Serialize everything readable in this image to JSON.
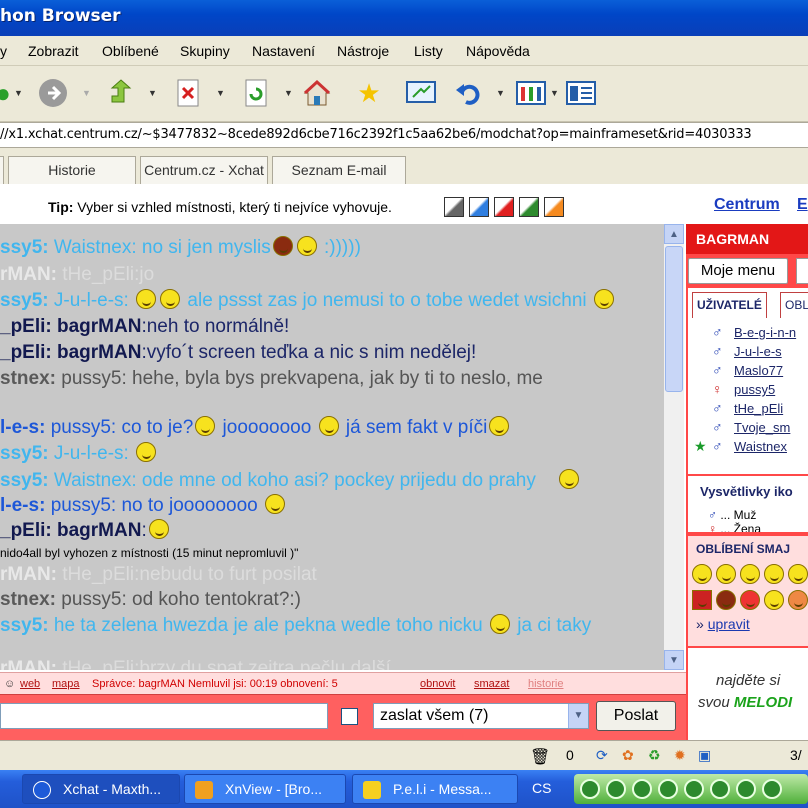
{
  "window": {
    "title": "hon Browser"
  },
  "menu": [
    "y",
    "Zobrazit",
    "Oblíbené",
    "Skupiny",
    "Nastavení",
    "Nástroje",
    "Listy",
    "Nápověda"
  ],
  "address": "//x1.xchat.centrum.cz/~$3477832~8cede892d6cbe716c2392f1c5aa62be6/modchat?op=mainframeset&rid=4030333",
  "tabs": [
    "Historie",
    "Centrum.cz - Xchat",
    "Seznam E-mail"
  ],
  "tip": {
    "label": "Tip:",
    "text": "Vyber si vzhled místnosti, který ti nejvíce vyhovuje."
  },
  "top_links": [
    "Centrum",
    "E"
  ],
  "chat": [
    {
      "speaker": "ssy5:",
      "text": "Waistnex: no si jen myslis",
      "tail": " :)))))",
      "style": "light"
    },
    {
      "speaker": "rMAN:",
      "text": "tHe_pEli:jo",
      "style": "grey"
    },
    {
      "speaker": "ssy5:",
      "text": "J-u-l-e-s:",
      "mid": " ale pssst zas jo nemusi to o tobe wedet wsichni",
      "style": "light"
    },
    {
      "speaker": "_pEli: bagrMAN",
      "text": ":neh to normálně!",
      "style": "navy"
    },
    {
      "speaker": "_pEli: bagrMAN",
      "text": ":vyfo´t screen teďka a nic s nim nedělej!",
      "style": "navy"
    },
    {
      "speaker": "stnex:",
      "text": "pussy5: hehe, byla bys prekvapena, jak by ti to neslo, me",
      "style": "dark"
    },
    {
      "speaker": "l-e-s:",
      "text": "pussy5: co to je?",
      "mid": " joooooooo",
      "tail": " já sem fakt v píči",
      "style": "blue"
    },
    {
      "speaker": "ssy5:",
      "text": "J-u-l-e-s:",
      "style": "light"
    },
    {
      "speaker": "ssy5:",
      "text": "Waistnex: ode mne od koho asi? pockey prijedu do prahy",
      "style": "light"
    },
    {
      "speaker": "l-e-s:",
      "text": "pussy5: no to joooooooo",
      "style": "blue"
    },
    {
      "speaker": "_pEli: bagrMAN",
      "text": ":",
      "style": "navy"
    },
    {
      "speaker": "",
      "text": "nido4all byl vyhozen z místnosti (15 minut nepromluvil )\"",
      "style": "sys"
    },
    {
      "speaker": "rMAN:",
      "text": "tHe_pEli:nebudu to furt posilat",
      "style": "grey"
    },
    {
      "speaker": "stnex:",
      "text": "pussy5: od koho tentokrat?:)",
      "style": "dark"
    },
    {
      "speaker": "ssy5:",
      "text": "he ta zelena hwezda je ale pekna wedle toho nicku",
      "tail": " ja ci taky",
      "style": "light"
    },
    {
      "speaker": "rMAN:",
      "text": "tHe_pEli:brzy du spat zejtra pečlu další",
      "style": "grey"
    }
  ],
  "status_strip": {
    "links": [
      "web",
      "mapa"
    ],
    "text": "Správce: bagrMAN Nemluvil jsi: 00:19 obnovení: 5",
    "actions": [
      "obnovit",
      "smazat",
      "historie"
    ]
  },
  "input": {
    "recipient": "zaslat všem (7)",
    "send_label": "Poslat"
  },
  "right_panel": {
    "header": "BAGRMAN",
    "moje_menu": "Moje menu",
    "tab_users": "UŽIVATELÉ",
    "tab_other": "OBL",
    "users": [
      "B-e-g-i-n-n",
      "J-u-l-e-s",
      "Maslo77",
      "pussy5",
      "tHe_pEli",
      "Tvoje_sm",
      "Waistnex"
    ],
    "legend_title": "Vysvětlivky iko",
    "legend_item": "... Muž",
    "legend_item2": "... Žena",
    "fav_title": "OBLÍBENÍ SMAJ",
    "upravit_prefix": "»",
    "upravit": "upravit",
    "ad_line1": "najděte si",
    "ad_line2_a": "svou ",
    "ad_line2_b": "MELODI"
  },
  "statusbar": {
    "count": "0",
    "right": "3/"
  },
  "taskbar": {
    "items": [
      "Xchat - Maxth...",
      "XnView - [Bro...",
      "P.e.l.i - Messa..."
    ],
    "lang": "CS"
  },
  "colors": {
    "accent_red": "#e31717",
    "chat_bg": "#c8c8c8",
    "light_blue_text": "#41b6ee",
    "navy_text": "#1c2668"
  }
}
